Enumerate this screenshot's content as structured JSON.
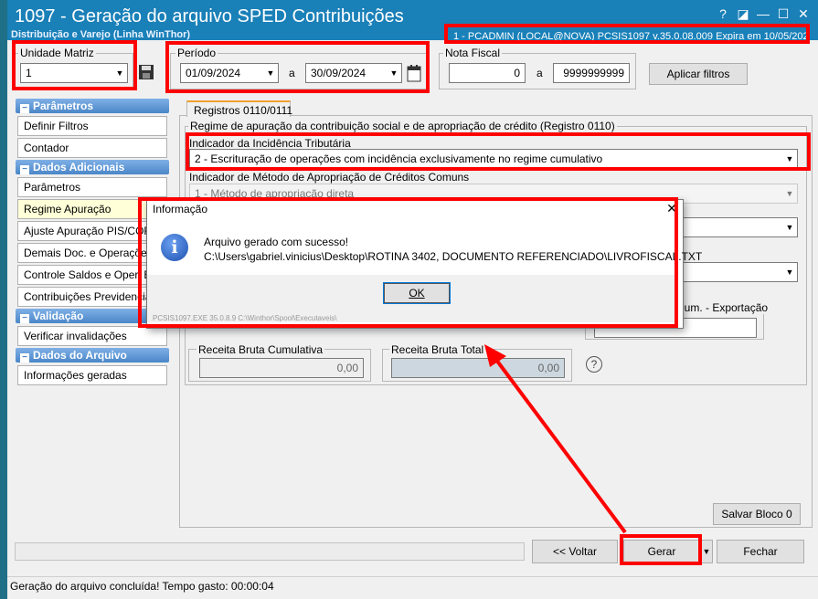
{
  "window": {
    "title": "1097 - Geração do arquivo SPED Contribuições",
    "subtitle": "Distribuição e Varejo (Linha WinThor)",
    "user_info": "1 - PCADMIN (LOCAL@NOVA)   PCSIS1097  v.35.0.08.009   Expira em 10/05/2025",
    "controls": {
      "help": "?",
      "restore": "◪",
      "minimize": "—",
      "maximize": "☐",
      "close": "✕"
    }
  },
  "filters": {
    "unidade_matriz": {
      "label": "Unidade Matriz",
      "value": "1"
    },
    "periodo": {
      "label": "Período",
      "start": "01/09/2024",
      "sep": "a",
      "end": "30/09/2024"
    },
    "nota_fiscal": {
      "label": "Nota Fiscal",
      "start": "0",
      "sep": "a",
      "end": "9999999999"
    },
    "apply_label": "Aplicar filtros"
  },
  "sidebar": {
    "sections": [
      {
        "title": "Parâmetros",
        "items": [
          "Definir Filtros",
          "Contador"
        ]
      },
      {
        "title": "Dados Adicionais",
        "items": [
          "Parâmetros",
          "Regime Apuração",
          "Ajuste Apuração PIS/COFINS",
          "Demais Doc. e Operações",
          "Controle Saldos e Oper. Ext.",
          "Contribuições Previdenciárias"
        ]
      },
      {
        "title": "Validação",
        "items": [
          "Verificar invalidações"
        ]
      },
      {
        "title": "Dados do Arquivo",
        "items": [
          "Informações geradas"
        ]
      }
    ],
    "selected": "Regime Apuração"
  },
  "main": {
    "tab": "Registros 0110/0111",
    "regime_group_label": "Regime de apuração da contribuição social e de apropriação de crédito (Registro 0110)",
    "indicador_incidencia": {
      "label": "Indicador da Incidência Tributária",
      "value": "2 - Escrituração de operações com incidência exclusivamente no regime cumulativo"
    },
    "indicador_metodo": {
      "label": "Indicador de Método de Apropriação de Créditos Comuns",
      "value": "1 - Método de apropriação direta"
    },
    "receita_export_label": "Cum. - Exportação",
    "receita_cumulativa": {
      "label": "Receita Bruta Cumulativa",
      "value": "0,00"
    },
    "receita_total": {
      "label": "Receita Bruta Total",
      "value": "0,00"
    },
    "help_glyph": "?",
    "salvar_bloco": "Salvar Bloco 0"
  },
  "bottom": {
    "voltar": "<< Voltar",
    "gerar": "Gerar",
    "fechar": "Fechar"
  },
  "status": "Geração do arquivo concluída! Tempo gasto: 00:00:04",
  "dialog": {
    "title": "Informação",
    "message": "Arquivo gerado com sucesso!",
    "path": "C:\\Users\\gabriel.vinicius\\Desktop\\ROTINA 3402, DOCUMENTO REFERENCIADO\\LIVROFISCAL.TXT",
    "ok": "OK",
    "footer": "PCSIS1097.EXE 35.0.8.9 C:\\Winthor\\Spool\\Executaveis\\"
  },
  "colors": {
    "titlebar": "#1a80b8",
    "highlight": "#ff0000",
    "section_header": "#4a86c8"
  }
}
